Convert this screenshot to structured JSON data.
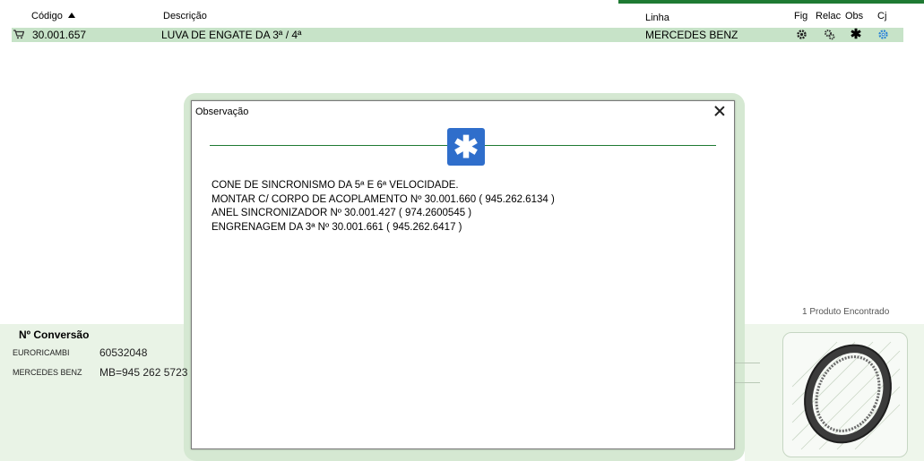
{
  "table": {
    "headers": {
      "codigo": "Código",
      "descricao": "Descrição",
      "linha": "Linha",
      "fig": "Fig",
      "relac": "Relac",
      "obs": "Obs",
      "cj": "Cj"
    },
    "rows": [
      {
        "codigo": "30.001.657",
        "descricao": "LUVA DE ENGATE DA 3ª / 4ª",
        "linha": "MERCEDES BENZ"
      }
    ]
  },
  "conversion": {
    "title": "Nº Conversão",
    "items": [
      {
        "name": "EURORICAMBI",
        "value": "60532048"
      },
      {
        "name": "MERCEDES BENZ",
        "value": "MB=945 262 5723"
      }
    ]
  },
  "results_count": "1 Produto Encontrado",
  "modal": {
    "title": "Observação",
    "lines": [
      "CONE DE SINCRONISMO DA 5ª E 6ª VELOCIDADE.",
      "MONTAR C/ CORPO DE ACOPLAMENTO Nº 30.001.660 ( 945.262.6134 )",
      "ANEL SINCRONIZADOR Nº 30.001.427 ( 974.2600545 )",
      "ENGRENAGEM DA 3ª Nº 30.001.661 ( 945.262.6417 )"
    ]
  },
  "colors": {
    "accent_green": "#1f7a33",
    "row_highlight": "#c7e3c8",
    "obs_badge": "#2f6ecb"
  },
  "icons": [
    "cart-icon",
    "gear-icon",
    "relation-gear-icon",
    "asterisk-icon",
    "cj-gear-icon",
    "close-icon",
    "asterisk-badge-icon"
  ]
}
